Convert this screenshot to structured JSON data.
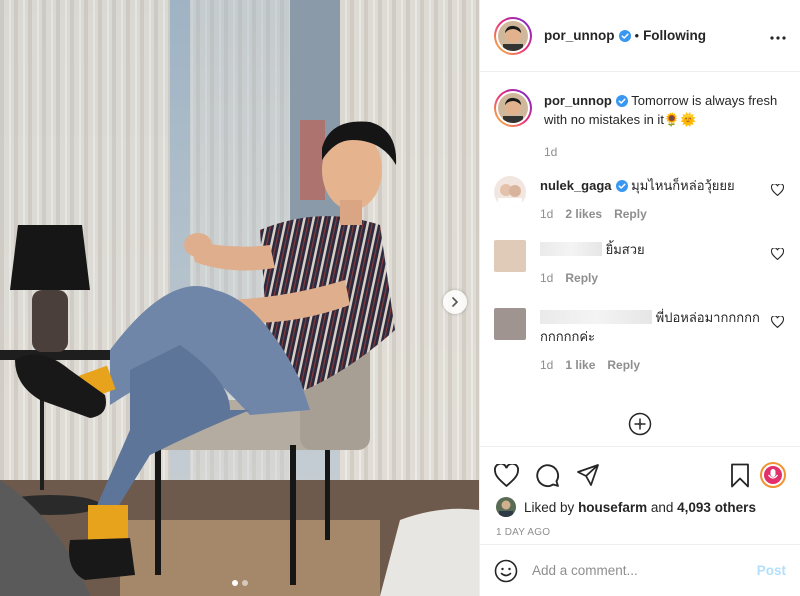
{
  "header": {
    "username": "por_unnop",
    "separator": "•",
    "follow_status": "Following"
  },
  "caption": {
    "username": "por_unnop",
    "text": "Tomorrow is always fresh with no mistakes in it🌻🌞",
    "time": "1d"
  },
  "comments": [
    {
      "username": "nulek_gaga",
      "verified": true,
      "text": "มุมไหนก็หล่อวุ้ยยย",
      "time": "1d",
      "likes": "2 likes",
      "reply": "Reply"
    },
    {
      "username": "",
      "text": "ยิ้มสวย",
      "time": "1d",
      "reply": "Reply"
    },
    {
      "username": "",
      "text": "พี่ปอหล่อมากกกกกกกกกกค่ะ",
      "time": "1d",
      "likes": "1 like",
      "reply": "Reply"
    }
  ],
  "likes": {
    "prefix": "Liked by",
    "user": "housefarm",
    "connector": "and",
    "others": "4,093 others"
  },
  "time_ago": "1 DAY AGO",
  "comment_input": {
    "placeholder": "Add a comment...",
    "post_label": "Post"
  },
  "colors": {
    "verified": "#3897f0",
    "post_disabled": "#b2dffc",
    "muted": "#8e8e8e"
  }
}
